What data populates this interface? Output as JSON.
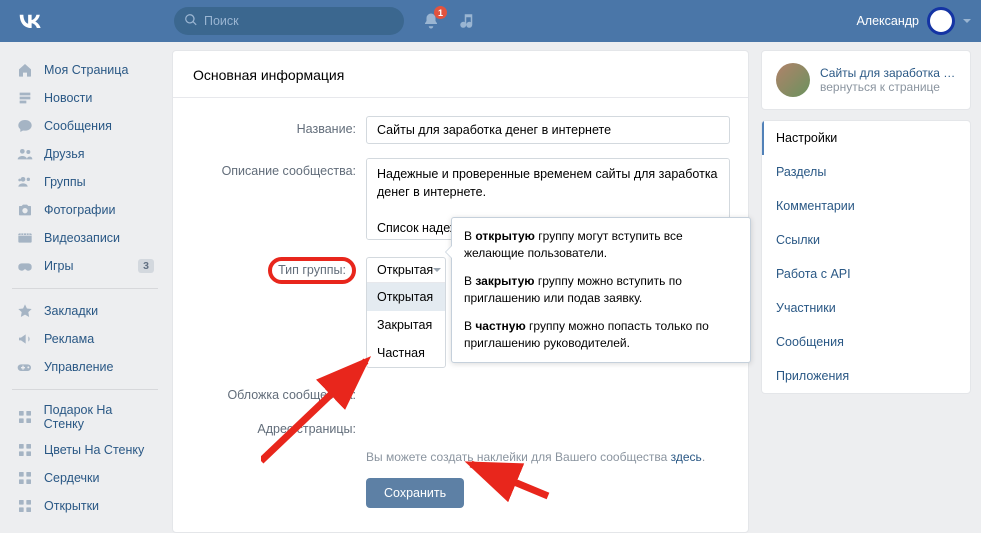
{
  "header": {
    "search_placeholder": "Поиск",
    "notif_count": "1",
    "username": "Александр"
  },
  "nav": {
    "items": [
      {
        "label": "Моя Страница",
        "icon": "home"
      },
      {
        "label": "Новости",
        "icon": "news"
      },
      {
        "label": "Сообщения",
        "icon": "msg"
      },
      {
        "label": "Друзья",
        "icon": "friends"
      },
      {
        "label": "Группы",
        "icon": "groups"
      },
      {
        "label": "Фотографии",
        "icon": "photo"
      },
      {
        "label": "Видеозаписи",
        "icon": "video"
      },
      {
        "label": "Игры",
        "icon": "games",
        "badge": "3"
      }
    ],
    "items2": [
      {
        "label": "Закладки",
        "icon": "star"
      },
      {
        "label": "Реклама",
        "icon": "ads"
      },
      {
        "label": "Управление",
        "icon": "manage"
      }
    ],
    "items3": [
      {
        "label": "Подарок На Стенку",
        "icon": "app"
      },
      {
        "label": "Цветы На Стенку",
        "icon": "app"
      },
      {
        "label": "Сердечки",
        "icon": "app"
      },
      {
        "label": "Открытки",
        "icon": "app"
      }
    ]
  },
  "main": {
    "title": "Основная информация",
    "labels": {
      "name": "Название:",
      "desc": "Описание сообщества:",
      "type": "Тип группы:",
      "cover": "Обложка сообщества:",
      "addr": "Адрес страницы:"
    },
    "fields": {
      "name_value": "Сайты для заработка денег в интернете",
      "desc_value": "Надежные и проверенные временем сайты для заработка денег в интернете.\n\nСписок надеж\nсмотрите на н"
    },
    "select": {
      "value": "Открытая",
      "options": [
        "Открытая",
        "Закрытая",
        "Частная"
      ]
    },
    "hint_prefix": "Вы можете создать наклейки для Вашего сообщества ",
    "hint_link": "здесь",
    "hint_suffix": ".",
    "save": "Сохранить"
  },
  "tooltip": {
    "p1_a": "В ",
    "p1_b": "открытую",
    "p1_c": " группу могут вступить все желающие пользователи.",
    "p2_a": "В ",
    "p2_b": "закрытую",
    "p2_c": " группу можно вступить по приглашению или подав заявку.",
    "p3_a": "В ",
    "p3_b": "частную",
    "p3_c": " группу можно попасть только по приглашению руководителей."
  },
  "right": {
    "group_name": "Сайты для заработка де...",
    "back": "вернуться к странице",
    "tabs": [
      "Настройки",
      "Разделы",
      "Комментарии",
      "Ссылки",
      "Работа с API",
      "Участники",
      "Сообщения",
      "Приложения"
    ],
    "active": 0
  }
}
